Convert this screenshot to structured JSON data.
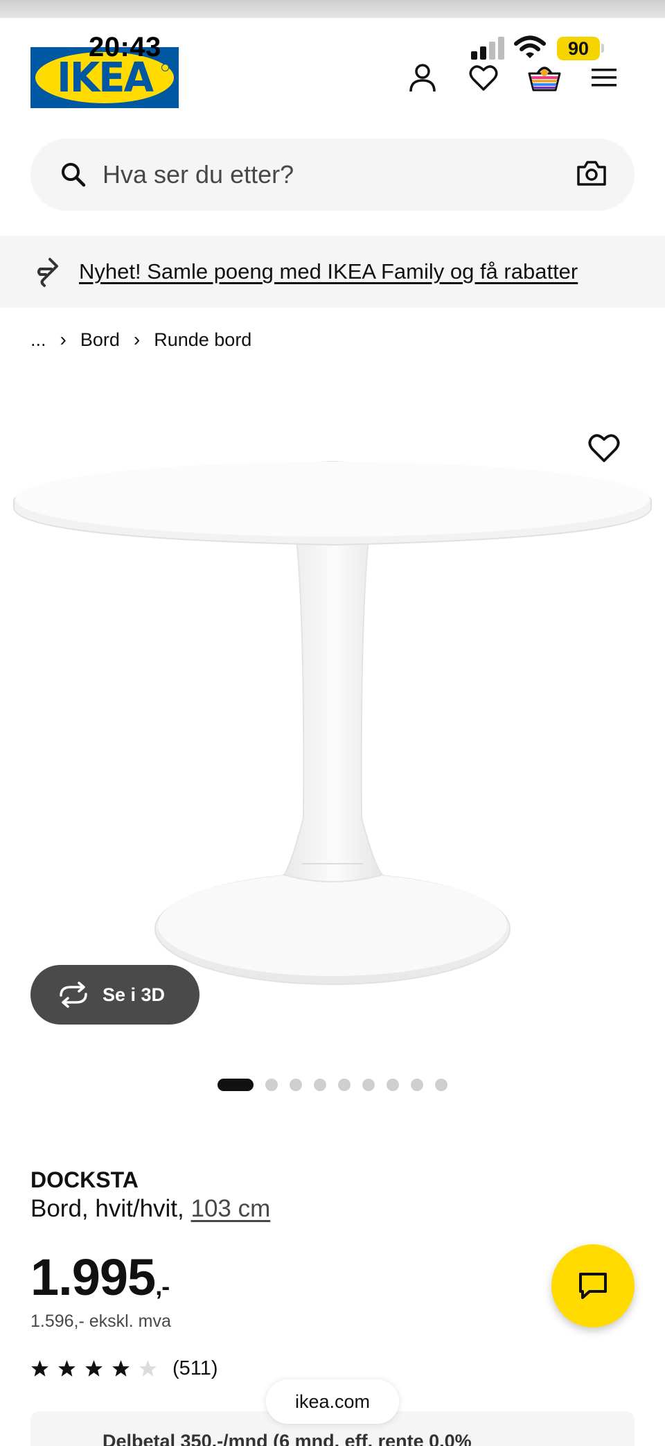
{
  "status_bar": {
    "time": "20:43",
    "battery": "90"
  },
  "header": {
    "logo_text": "IKEA",
    "icons": [
      "user-icon",
      "heart-icon",
      "basket-icon",
      "hamburger-menu-icon"
    ]
  },
  "search": {
    "placeholder": "Hva ser du etter?"
  },
  "promo": {
    "text": "Nyhet! Samle poeng med IKEA Family og få rabatter"
  },
  "breadcrumb": {
    "items": [
      "...",
      "Bord",
      "Runde bord"
    ]
  },
  "gallery": {
    "view_3d_label": "Se i 3D",
    "image_count": 9,
    "active_index": 0
  },
  "product": {
    "name": "DOCKSTA",
    "description": "Bord, hvit/hvit,",
    "size": "103 cm",
    "price_main": "1.995",
    "price_suffix": ",-",
    "price_excl_vat": "1.596,- ekskl. mva",
    "rating_value": 4,
    "rating_max": 5,
    "review_count": "(511)"
  },
  "installment": {
    "text": "Delbetal 350,-/mnd (6 mnd, eff. rente 0,0%"
  },
  "browser": {
    "url": "ikea.com"
  },
  "colors": {
    "brand_blue": "#0058a3",
    "brand_yellow": "#ffdb00",
    "text": "#111111"
  }
}
